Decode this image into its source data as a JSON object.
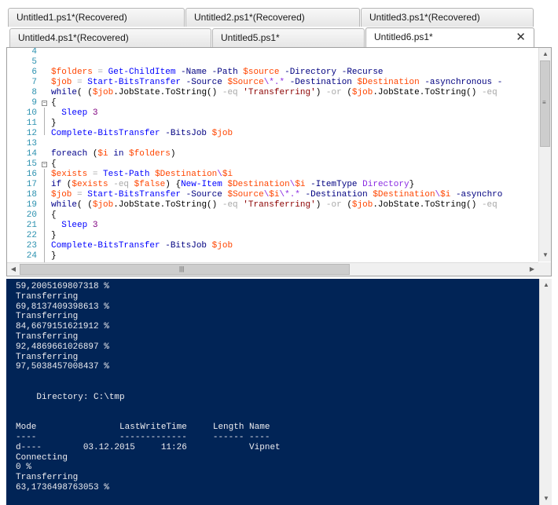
{
  "tabs_row1": [
    {
      "label": "Untitled1.ps1*(Recovered)"
    },
    {
      "label": "Untitled2.ps1*(Recovered)"
    },
    {
      "label": "Untitled3.ps1*(Recovered)"
    }
  ],
  "tabs_row2": [
    {
      "label": "Untitled4.ps1*(Recovered)"
    },
    {
      "label": "Untitled5.ps1*"
    },
    {
      "label": "Untitled6.ps1*",
      "close": "✕"
    }
  ],
  "editor": {
    "lines": [
      {
        "num": "4",
        "tokens": []
      },
      {
        "num": "5",
        "tokens": []
      },
      {
        "num": "6",
        "tokens": [
          [
            "var",
            "$folders"
          ],
          [
            "op",
            " = "
          ],
          [
            "cmd",
            "Get-ChildItem"
          ],
          [
            "param",
            " -Name -Path "
          ],
          [
            "var",
            "$source"
          ],
          [
            "param",
            " -Directory -Recurse"
          ]
        ]
      },
      {
        "num": "7",
        "tokens": [
          [
            "var",
            "$job"
          ],
          [
            "op",
            " = "
          ],
          [
            "cmd",
            "Start-BitsTransfer"
          ],
          [
            "param",
            " -Source "
          ],
          [
            "var",
            "$Source"
          ],
          [
            "arg",
            "\\*.*"
          ],
          [
            "param",
            " -Destination "
          ],
          [
            "var",
            "$Destination"
          ],
          [
            "param",
            " -asynchronous -"
          ]
        ]
      },
      {
        "num": "8",
        "tokens": [
          [
            "kw",
            "while"
          ],
          [
            "plain",
            "( ("
          ],
          [
            "var",
            "$job"
          ],
          [
            "plain",
            ".JobState.ToString() "
          ],
          [
            "op",
            "-eq"
          ],
          [
            "plain",
            " "
          ],
          [
            "str",
            "'Transferring'"
          ],
          [
            "plain",
            ") "
          ],
          [
            "op",
            "-or"
          ],
          [
            "plain",
            " ("
          ],
          [
            "var",
            "$job"
          ],
          [
            "plain",
            ".JobState.ToString() "
          ],
          [
            "op",
            "-eq"
          ]
        ]
      },
      {
        "num": "9",
        "tokens": [
          [
            "plain",
            "{"
          ]
        ]
      },
      {
        "num": "10",
        "tokens": [
          [
            "plain",
            "  "
          ],
          [
            "cmd",
            "Sleep"
          ],
          [
            "plain",
            " "
          ],
          [
            "num",
            "3"
          ]
        ]
      },
      {
        "num": "11",
        "tokens": [
          [
            "plain",
            "}"
          ]
        ]
      },
      {
        "num": "12",
        "tokens": [
          [
            "cmd",
            "Complete-BitsTransfer"
          ],
          [
            "param",
            " -BitsJob "
          ],
          [
            "var",
            "$job"
          ]
        ]
      },
      {
        "num": "13",
        "tokens": []
      },
      {
        "num": "14",
        "tokens": [
          [
            "kw",
            "foreach"
          ],
          [
            "plain",
            " ("
          ],
          [
            "var",
            "$i"
          ],
          [
            "kw",
            " in "
          ],
          [
            "var",
            "$folders"
          ],
          [
            "plain",
            ")"
          ]
        ]
      },
      {
        "num": "15",
        "tokens": [
          [
            "plain",
            "{"
          ]
        ]
      },
      {
        "num": "16",
        "tokens": [
          [
            "var",
            "$exists"
          ],
          [
            "op",
            " = "
          ],
          [
            "cmd",
            "Test-Path"
          ],
          [
            "plain",
            " "
          ],
          [
            "var",
            "$Destination"
          ],
          [
            "arg",
            "\\"
          ],
          [
            "var",
            "$i"
          ]
        ]
      },
      {
        "num": "17",
        "tokens": [
          [
            "kw",
            "if"
          ],
          [
            "plain",
            " ("
          ],
          [
            "var",
            "$exists"
          ],
          [
            "op",
            " -eq "
          ],
          [
            "var",
            "$false"
          ],
          [
            "plain",
            ") {"
          ],
          [
            "cmd",
            "New-Item"
          ],
          [
            "plain",
            " "
          ],
          [
            "var",
            "$Destination"
          ],
          [
            "arg",
            "\\"
          ],
          [
            "var",
            "$i"
          ],
          [
            "param",
            " -ItemType "
          ],
          [
            "arg",
            "Directory"
          ],
          [
            "plain",
            "}"
          ]
        ]
      },
      {
        "num": "18",
        "tokens": [
          [
            "var",
            "$job"
          ],
          [
            "op",
            " = "
          ],
          [
            "cmd",
            "Start-BitsTransfer"
          ],
          [
            "param",
            " -Source "
          ],
          [
            "var",
            "$Source"
          ],
          [
            "arg",
            "\\"
          ],
          [
            "var",
            "$i"
          ],
          [
            "arg",
            "\\*.*"
          ],
          [
            "param",
            " -Destination "
          ],
          [
            "var",
            "$Destination"
          ],
          [
            "arg",
            "\\"
          ],
          [
            "var",
            "$i"
          ],
          [
            "param",
            " -asynchro"
          ]
        ]
      },
      {
        "num": "19",
        "tokens": [
          [
            "kw",
            "while"
          ],
          [
            "plain",
            "( ("
          ],
          [
            "var",
            "$job"
          ],
          [
            "plain",
            ".JobState.ToString() "
          ],
          [
            "op",
            "-eq"
          ],
          [
            "plain",
            " "
          ],
          [
            "str",
            "'Transferring'"
          ],
          [
            "plain",
            ") "
          ],
          [
            "op",
            "-or"
          ],
          [
            "plain",
            " ("
          ],
          [
            "var",
            "$job"
          ],
          [
            "plain",
            ".JobState.ToString() "
          ],
          [
            "op",
            "-eq"
          ]
        ]
      },
      {
        "num": "20",
        "tokens": [
          [
            "plain",
            "{"
          ]
        ]
      },
      {
        "num": "21",
        "tokens": [
          [
            "plain",
            "  "
          ],
          [
            "cmd",
            "Sleep"
          ],
          [
            "plain",
            " "
          ],
          [
            "num",
            "3"
          ]
        ]
      },
      {
        "num": "22",
        "tokens": [
          [
            "plain",
            "}"
          ]
        ]
      },
      {
        "num": "23",
        "tokens": [
          [
            "cmd",
            "Complete-BitsTransfer"
          ],
          [
            "param",
            " -BitsJob "
          ],
          [
            "var",
            "$job"
          ]
        ]
      },
      {
        "num": "24",
        "tokens": [
          [
            "plain",
            "}"
          ]
        ]
      }
    ],
    "vscroll_grip": "≡",
    "hscroll_grip": "|||",
    "scroll_up": "▲",
    "scroll_down": "▼",
    "scroll_left": "◀",
    "scroll_right": "▶"
  },
  "console": {
    "lines": [
      "59,2005169807318 %",
      "Transferring",
      "69,8137409398613 %",
      "Transferring",
      "84,6679151621912 %",
      "Transferring",
      "92,4869661026897 %",
      "Transferring",
      "97,5038457008437 %",
      "",
      "",
      "    Directory: C:\\tmp",
      "",
      "",
      "Mode                LastWriteTime     Length Name",
      "----                -------------     ------ ----",
      "d----        03.12.2015     11:26            Vipnet",
      "Connecting",
      "0 %",
      "Transferring",
      "63,1736498763053 %"
    ],
    "scroll_up": "▲",
    "scroll_down": "▼"
  }
}
